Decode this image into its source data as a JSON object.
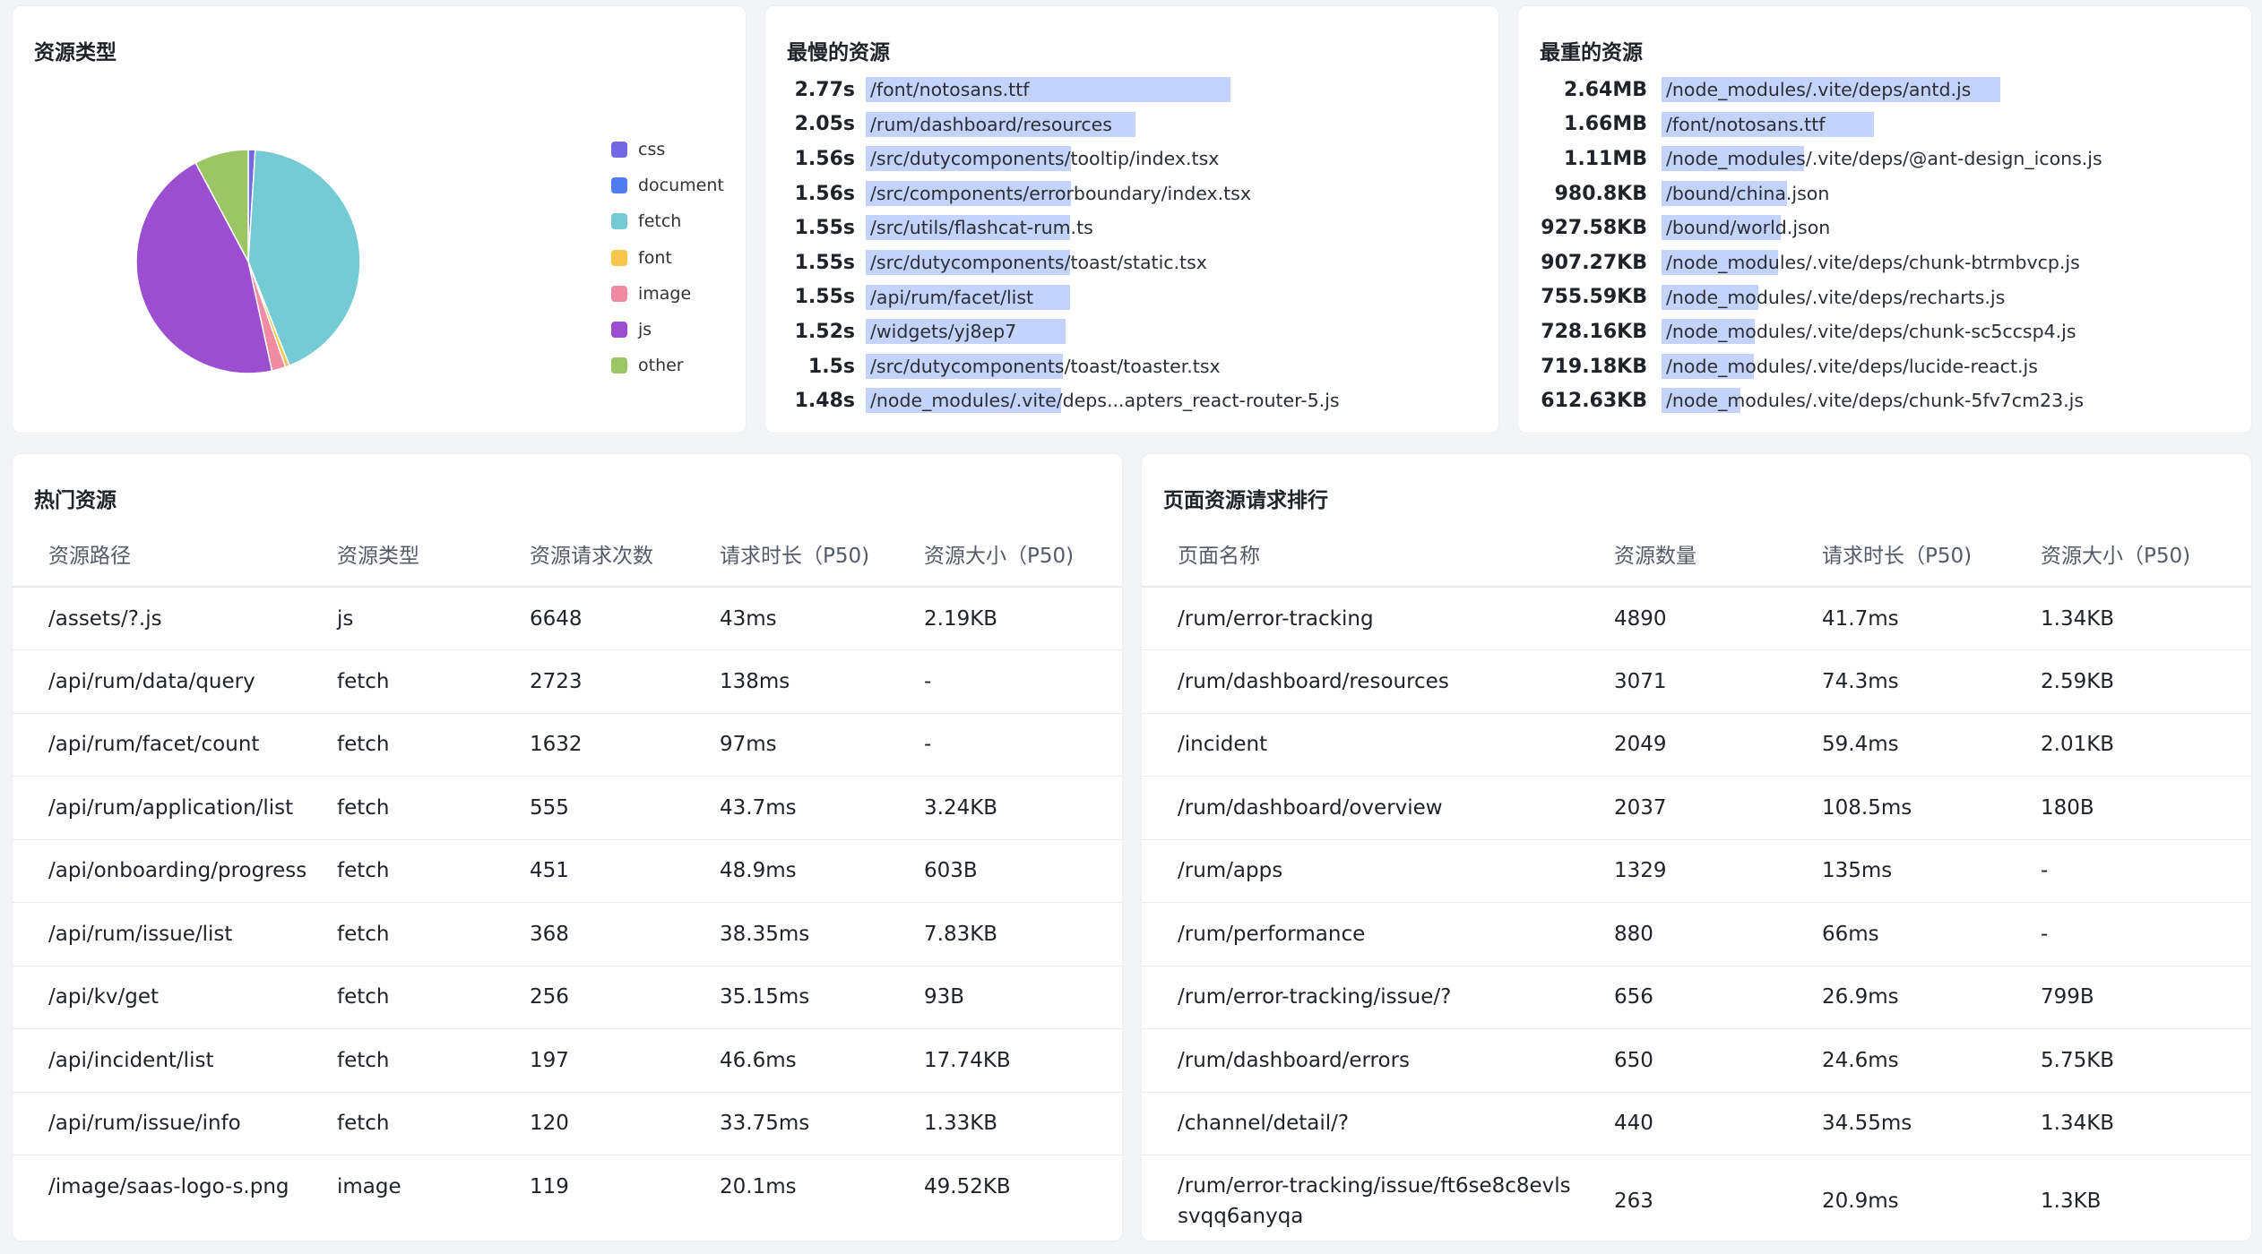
{
  "resource_types": {
    "title": "资源类型",
    "legend": [
      {
        "name": "css",
        "color": "#7468e0"
      },
      {
        "name": "document",
        "color": "#4f7df0"
      },
      {
        "name": "fetch",
        "color": "#74cbd3"
      },
      {
        "name": "font",
        "color": "#f5c64a"
      },
      {
        "name": "image",
        "color": "#ef8ba2"
      },
      {
        "name": "js",
        "color": "#9b4fd0"
      },
      {
        "name": "other",
        "color": "#9cc566"
      }
    ],
    "chart_data": {
      "type": "pie",
      "slices": [
        {
          "name": "css",
          "value": 1.0
        },
        {
          "name": "fetch",
          "value": 43.0
        },
        {
          "name": "font",
          "value": 0.6
        },
        {
          "name": "image",
          "value": 2.0
        },
        {
          "name": "js",
          "value": 45.6
        },
        {
          "name": "other",
          "value": 7.8
        }
      ]
    }
  },
  "slowest": {
    "title": "最慢的资源",
    "items": [
      {
        "value": "2.77s",
        "label": "/font/notosans.ttf",
        "amount": 2.77
      },
      {
        "value": "2.05s",
        "label": "/rum/dashboard/resources",
        "amount": 2.05
      },
      {
        "value": "1.56s",
        "label": "/src/dutycomponents/tooltip/index.tsx",
        "amount": 1.56
      },
      {
        "value": "1.56s",
        "label": "/src/components/errorboundary/index.tsx",
        "amount": 1.56
      },
      {
        "value": "1.55s",
        "label": "/src/utils/flashcat-rum.ts",
        "amount": 1.55
      },
      {
        "value": "1.55s",
        "label": "/src/dutycomponents/toast/static.tsx",
        "amount": 1.55
      },
      {
        "value": "1.55s",
        "label": "/api/rum/facet/list",
        "amount": 1.55
      },
      {
        "value": "1.52s",
        "label": "/widgets/yj8ep7",
        "amount": 1.52
      },
      {
        "value": "1.5s",
        "label": "/src/dutycomponents/toast/toaster.tsx",
        "amount": 1.5
      },
      {
        "value": "1.48s",
        "label": "/node_modules/.vite/deps...apters_react-router-5.js",
        "amount": 1.48
      }
    ]
  },
  "heaviest": {
    "title": "最重的资源",
    "items": [
      {
        "value": "2.64MB",
        "label": "/node_modules/.vite/deps/antd.js",
        "amount": 2640
      },
      {
        "value": "1.66MB",
        "label": "/font/notosans.ttf",
        "amount": 1660
      },
      {
        "value": "1.11MB",
        "label": "/node_modules/.vite/deps/@ant-design_icons.js",
        "amount": 1110
      },
      {
        "value": "980.8KB",
        "label": "/bound/china.json",
        "amount": 980.8
      },
      {
        "value": "927.58KB",
        "label": "/bound/world.json",
        "amount": 927.58
      },
      {
        "value": "907.27KB",
        "label": "/node_modules/.vite/deps/chunk-btrmbvcp.js",
        "amount": 907.27
      },
      {
        "value": "755.59KB",
        "label": "/node_modules/.vite/deps/recharts.js",
        "amount": 755.59
      },
      {
        "value": "728.16KB",
        "label": "/node_modules/.vite/deps/chunk-sc5ccsp4.js",
        "amount": 728.16
      },
      {
        "value": "719.18KB",
        "label": "/node_modules/.vite/deps/lucide-react.js",
        "amount": 719.18
      },
      {
        "value": "612.63KB",
        "label": "/node_modules/.vite/deps/chunk-5fv7cm23.js",
        "amount": 612.63
      }
    ]
  },
  "hot": {
    "title": "热门资源",
    "columns": [
      "资源路径",
      "资源类型",
      "资源请求次数",
      "请求时长（P50)",
      "资源大小（P50)"
    ],
    "rows": [
      [
        "/assets/?.js",
        "js",
        "6648",
        "43ms",
        "2.19KB"
      ],
      [
        "/api/rum/data/query",
        "fetch",
        "2723",
        "138ms",
        "-"
      ],
      [
        "/api/rum/facet/count",
        "fetch",
        "1632",
        "97ms",
        "-"
      ],
      [
        "/api/rum/application/list",
        "fetch",
        "555",
        "43.7ms",
        "3.24KB"
      ],
      [
        "/api/onboarding/progress",
        "fetch",
        "451",
        "48.9ms",
        "603B"
      ],
      [
        "/api/rum/issue/list",
        "fetch",
        "368",
        "38.35ms",
        "7.83KB"
      ],
      [
        "/api/kv/get",
        "fetch",
        "256",
        "35.15ms",
        "93B"
      ],
      [
        "/api/incident/list",
        "fetch",
        "197",
        "46.6ms",
        "17.74KB"
      ],
      [
        "/api/rum/issue/info",
        "fetch",
        "120",
        "33.75ms",
        "1.33KB"
      ],
      [
        "/image/saas-logo-s.png",
        "image",
        "119",
        "20.1ms",
        "49.52KB"
      ]
    ]
  },
  "ranking": {
    "title": "页面资源请求排行",
    "columns": [
      "页面名称",
      "资源数量",
      "请求时长（P50)",
      "资源大小（P50)"
    ],
    "rows": [
      [
        "/rum/error-tracking",
        "4890",
        "41.7ms",
        "1.34KB"
      ],
      [
        "/rum/dashboard/resources",
        "3071",
        "74.3ms",
        "2.59KB"
      ],
      [
        "/incident",
        "2049",
        "59.4ms",
        "2.01KB"
      ],
      [
        "/rum/dashboard/overview",
        "2037",
        "108.5ms",
        "180B"
      ],
      [
        "/rum/apps",
        "1329",
        "135ms",
        "-"
      ],
      [
        "/rum/performance",
        "880",
        "66ms",
        "-"
      ],
      [
        "/rum/error-tracking/issue/?",
        "656",
        "26.9ms",
        "799B"
      ],
      [
        "/rum/dashboard/errors",
        "650",
        "24.6ms",
        "5.75KB"
      ],
      [
        "/channel/detail/?",
        "440",
        "34.55ms",
        "1.34KB"
      ],
      [
        "/rum/error-tracking/issue/ft6se8c8evlssvqq6anyqa",
        "263",
        "20.9ms",
        "1.3KB"
      ]
    ]
  }
}
